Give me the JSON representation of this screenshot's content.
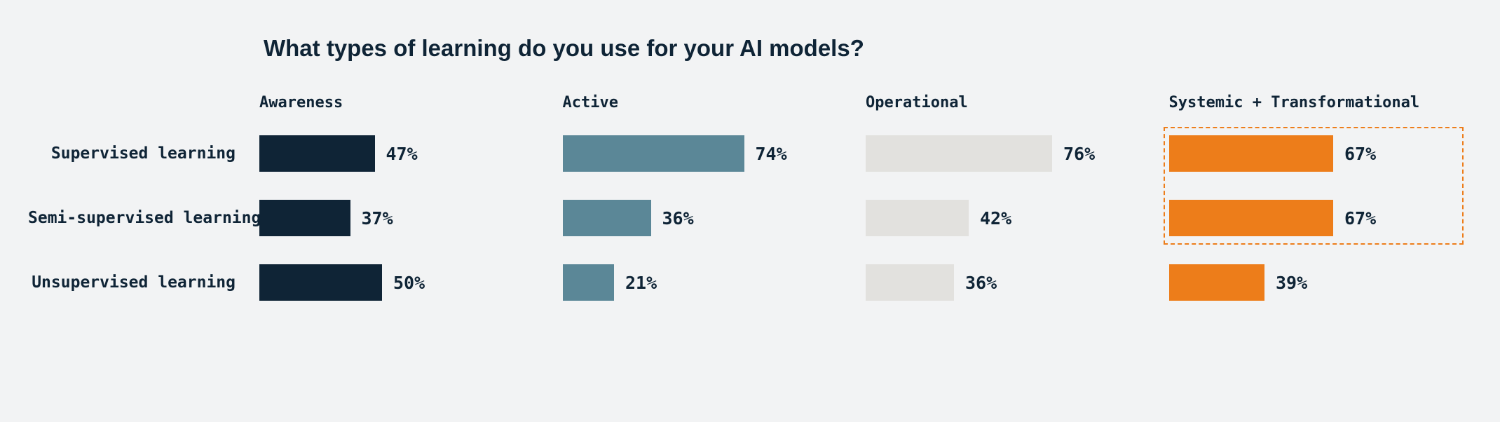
{
  "title": "What types of learning do you use for your AI models?",
  "chart_data": {
    "type": "bar",
    "title": "What types of learning do you use for your AI models?",
    "categories": [
      "Supervised learning",
      "Semi-supervised learning",
      "Unsupervised learning"
    ],
    "series": [
      {
        "name": "Awareness",
        "color": "#0f2436",
        "values": [
          47,
          37,
          50
        ]
      },
      {
        "name": "Active",
        "color": "#5b8797",
        "values": [
          74,
          36,
          21
        ]
      },
      {
        "name": "Operational",
        "color": "#e2e1de",
        "values": [
          76,
          42,
          36
        ]
      },
      {
        "name": "Systemic + Transformational",
        "color": "#ed7d1a",
        "values": [
          67,
          67,
          39
        ]
      }
    ],
    "xlabel": "",
    "ylabel": "",
    "ylim": [
      0,
      100
    ],
    "value_suffix": "%",
    "highlight": {
      "series_index": 3,
      "row_start": 0,
      "row_end": 1
    }
  }
}
